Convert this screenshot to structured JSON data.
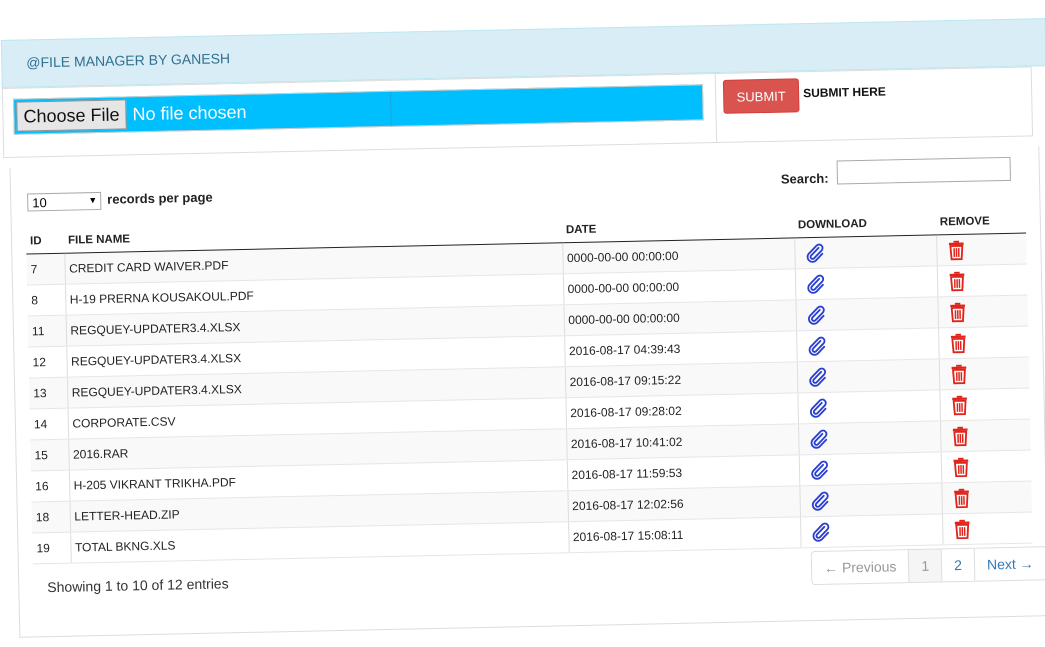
{
  "header": {
    "title": "@FILE MANAGER BY GANESH"
  },
  "upload": {
    "choose_label": "Choose File",
    "no_file_text": "No file chosen",
    "submit_label": "SUBMIT",
    "submit_note": "SUBMIT HERE"
  },
  "table_controls": {
    "length_value": "10",
    "length_label": "records per page",
    "search_label": "Search:",
    "search_value": ""
  },
  "columns": {
    "id": "ID",
    "name": "FILE NAME",
    "date": "DATE",
    "download": "DOWNLOAD",
    "remove": "REMOVE"
  },
  "rows": [
    {
      "id": "7",
      "name": "CREDIT CARD WAIVER.PDF",
      "date": "0000-00-00 00:00:00"
    },
    {
      "id": "8",
      "name": "H-19 PRERNA KOUSAKOUL.PDF",
      "date": "0000-00-00 00:00:00"
    },
    {
      "id": "11",
      "name": "REGQUEY-UPDATER3.4.XLSX",
      "date": "0000-00-00 00:00:00"
    },
    {
      "id": "12",
      "name": "REGQUEY-UPDATER3.4.XLSX",
      "date": "2016-08-17 04:39:43"
    },
    {
      "id": "13",
      "name": "REGQUEY-UPDATER3.4.XLSX",
      "date": "2016-08-17 09:15:22"
    },
    {
      "id": "14",
      "name": "CORPORATE.CSV",
      "date": "2016-08-17 09:28:02"
    },
    {
      "id": "15",
      "name": "2016.RAR",
      "date": "2016-08-17 10:41:02"
    },
    {
      "id": "16",
      "name": "H-205 VIKRANT TRIKHA.PDF",
      "date": "2016-08-17 11:59:53"
    },
    {
      "id": "18",
      "name": "LETTER-HEAD.ZIP",
      "date": "2016-08-17 12:02:56"
    },
    {
      "id": "19",
      "name": "TOTAL BKNG.XLS",
      "date": "2016-08-17 15:08:11"
    }
  ],
  "icons": {
    "download": "paperclip-icon",
    "remove": "trash-icon"
  },
  "colors": {
    "header_bg": "#d9edf7",
    "file_input_bg": "#00bfff",
    "submit_bg": "#d9534f",
    "paperclip": "#2a3fcf",
    "trash": "#e0241b"
  },
  "footer": {
    "info": "Showing 1 to 10 of 12 entries"
  },
  "pagination": {
    "previous": "← Previous",
    "pages": [
      "1",
      "2"
    ],
    "next": "Next →"
  }
}
